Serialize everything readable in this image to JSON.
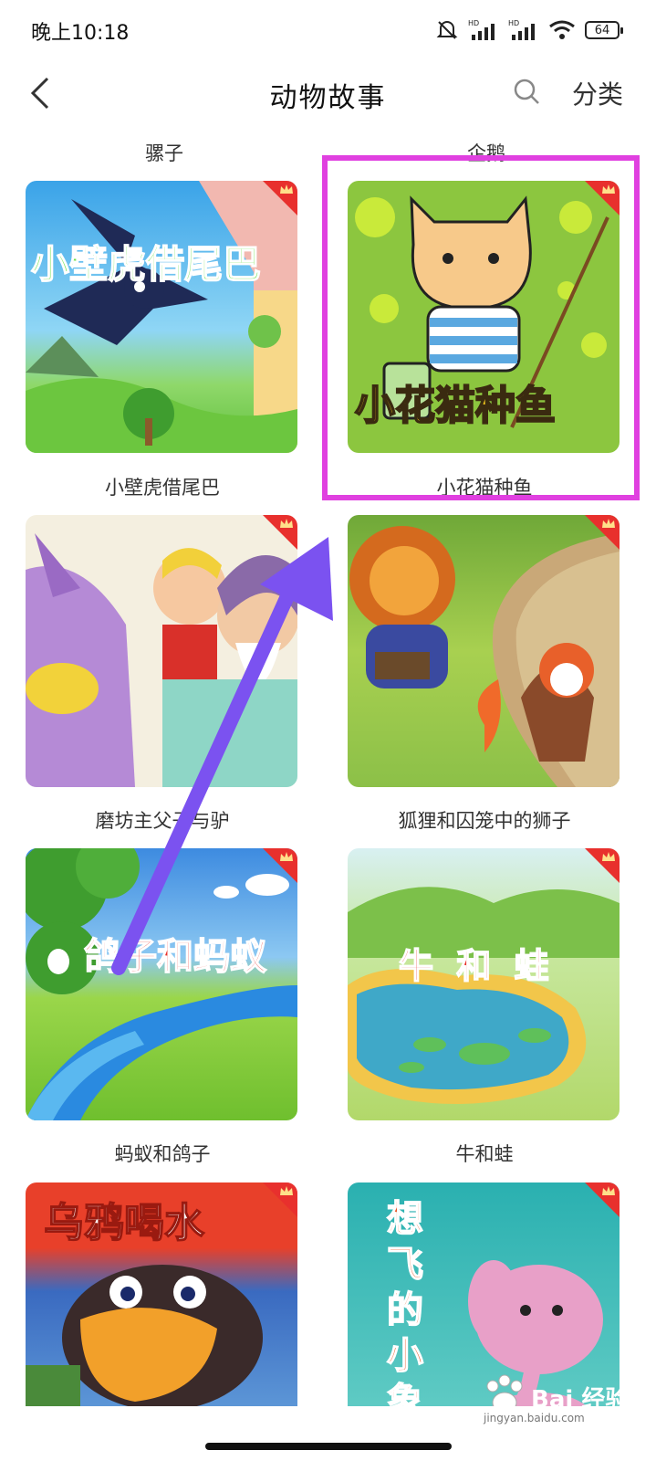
{
  "status": {
    "time": "晚上10:18",
    "battery": "64",
    "icons": [
      "mute-bell-icon",
      "hd-signal-icon",
      "hd-signal-icon",
      "wifi-icon",
      "battery-icon"
    ]
  },
  "header": {
    "title": "动物故事",
    "category_label": "分类"
  },
  "top_labels": [
    "骡子",
    "企鹅"
  ],
  "stories": [
    {
      "label": "小壁虎借尾巴",
      "cover_text": "小壁虎借尾巴"
    },
    {
      "label": "小花猫种鱼",
      "cover_text": "小花猫种鱼"
    },
    {
      "label": "磨坊主父子与驴",
      "cover_text": ""
    },
    {
      "label": "狐狸和囚笼中的狮子",
      "cover_text": ""
    },
    {
      "label": "蚂蚁和鸽子",
      "cover_text": "鸽子和蚂蚁"
    },
    {
      "label": "牛和蛙",
      "cover_text": "牛 和 蛙"
    },
    {
      "label": "",
      "cover_text": "乌鸦喝水"
    },
    {
      "label": "",
      "cover_text": "想飞的小象"
    }
  ],
  "watermark": {
    "text": "Bai 经验",
    "url": "jingyan.baidu.com"
  },
  "colors": {
    "highlight": "#e040e0",
    "arrow": "#7b52f0",
    "crown": "#e8302d"
  }
}
